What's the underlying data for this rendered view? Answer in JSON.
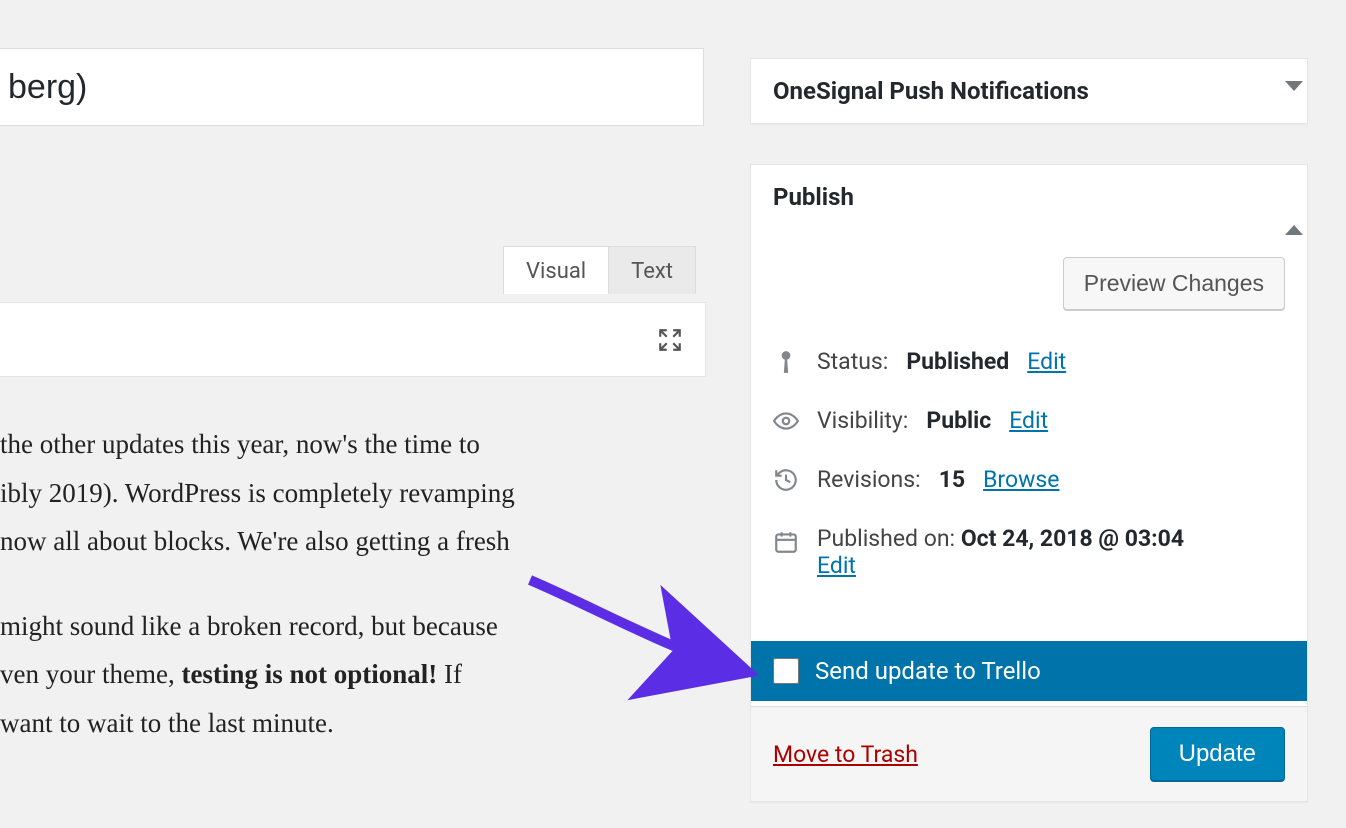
{
  "title": "berg)",
  "editor": {
    "tab_visual": "Visual",
    "tab_text": "Text",
    "para1_a": " the other updates this year, now's the time to ",
    "para1_b": "ibly 2019). WordPress is completely revamping ",
    "para1_c": "now all about blocks. We're also getting a fresh ",
    "para2_a": "might sound like a broken record, but because ",
    "para2_b": "ven your theme, ",
    "para2_strong": "testing is not optional!",
    "para2_c": " If ",
    "para2_d": "want to wait to the last minute."
  },
  "sidebar": {
    "onesignal": {
      "title": "OneSignal Push Notifications"
    },
    "publish": {
      "title": "Publish",
      "preview_label": "Preview Changes",
      "status_label": "Status:",
      "status_value": "Published",
      "status_edit": "Edit",
      "visibility_label": "Visibility:",
      "visibility_value": "Public",
      "visibility_edit": "Edit",
      "revisions_label": "Revisions:",
      "revisions_value": "15",
      "revisions_browse": "Browse",
      "published_label": "Published on:",
      "published_value": "Oct 24, 2018 @ 03:04",
      "published_edit": "Edit",
      "trello_label": "Send update to Trello",
      "trash_label": "Move to Trash",
      "update_label": "Update"
    }
  }
}
